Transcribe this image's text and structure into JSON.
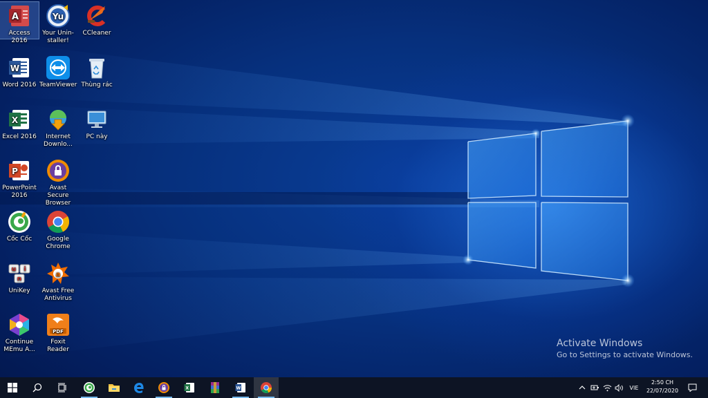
{
  "desktop": {
    "icons": [
      {
        "label": "Access 2016",
        "icon": "access-icon"
      },
      {
        "label": "Your Unin-staller!",
        "icon": "uninstaller-icon"
      },
      {
        "label": "CCleaner",
        "icon": "ccleaner-icon"
      },
      {
        "label": "Word 2016",
        "icon": "word-icon"
      },
      {
        "label": "TeamViewer",
        "icon": "teamviewer-icon"
      },
      {
        "label": "Thùng rác",
        "icon": "recycle-bin-icon"
      },
      {
        "label": "Excel 2016",
        "icon": "excel-icon"
      },
      {
        "label": "Internet Downlo...",
        "icon": "idm-icon"
      },
      {
        "label": "PC này",
        "icon": "this-pc-icon"
      },
      {
        "label": "PowerPoint 2016",
        "icon": "powerpoint-icon"
      },
      {
        "label": "Avast Secure Browser",
        "icon": "avast-browser-icon"
      },
      {
        "label": "Cốc Cốc",
        "icon": "coccoc-icon"
      },
      {
        "label": "Google Chrome",
        "icon": "chrome-icon"
      },
      {
        "label": "UniKey",
        "icon": "unikey-icon"
      },
      {
        "label": "Avast Free Antivirus",
        "icon": "avast-antivirus-icon"
      },
      {
        "label": "Continue MEmu A...",
        "icon": "memu-icon"
      },
      {
        "label": "Foxit Reader",
        "icon": "foxit-icon"
      }
    ],
    "selected": "Access 2016"
  },
  "watermark": {
    "title": "Activate Windows",
    "subtitle": "Go to Settings to activate Windows."
  },
  "taskbar": {
    "pinned": [
      {
        "name": "start-button",
        "icon": "windows-logo-icon"
      },
      {
        "name": "search-button",
        "icon": "search-icon"
      },
      {
        "name": "task-view-button",
        "icon": "task-view-icon"
      },
      {
        "name": "taskbar-coccoc",
        "icon": "coccoc-icon"
      },
      {
        "name": "taskbar-file-explorer",
        "icon": "folder-icon"
      },
      {
        "name": "taskbar-edge",
        "icon": "edge-icon"
      },
      {
        "name": "taskbar-avast-browser",
        "icon": "avast-browser-icon"
      },
      {
        "name": "taskbar-excel",
        "icon": "excel-icon"
      },
      {
        "name": "taskbar-winrar",
        "icon": "winrar-icon"
      },
      {
        "name": "taskbar-word",
        "icon": "word-icon"
      },
      {
        "name": "taskbar-chrome",
        "icon": "chrome-icon"
      }
    ],
    "tray": {
      "chevron_icon": "chevron-up-icon",
      "power_icon": "battery-icon",
      "network_icon": "wifi-icon",
      "volume_icon": "volume-icon",
      "language": "VIE",
      "time": "2:50 CH",
      "date": "22/07/2020",
      "notifications_icon": "notifications-icon"
    }
  },
  "colors": {
    "accent": "#76b9ed",
    "taskbar": "#0d1424",
    "wallpaper_light": "#9fd6ff"
  }
}
